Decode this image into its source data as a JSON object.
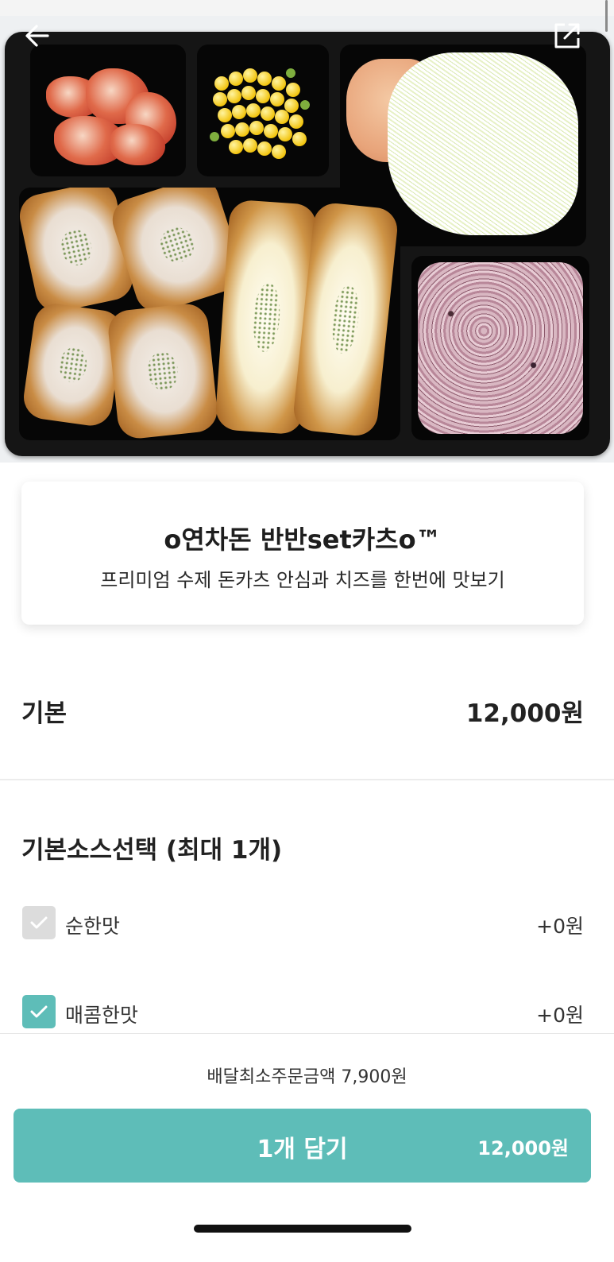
{
  "product": {
    "name": "o연차돈 반반set카츠o™",
    "description": "프리미엄 수제 돈카츠 안심과 치즈를 한번에 맛보기"
  },
  "base_price": {
    "label": "기본",
    "value": "12,000원"
  },
  "sauce_section": {
    "title": "기본소스선택 (최대 1개)",
    "options": [
      {
        "label": "순한맛",
        "price": "+0원",
        "state": "disabled"
      },
      {
        "label": "매콤한맛",
        "price": "+0원",
        "state": "checked"
      }
    ]
  },
  "footer": {
    "min_order_text": "배달최소주문금액 7,900원",
    "add_button_label": "1개 담기",
    "add_button_price": "12,000원"
  },
  "colors": {
    "accent": "#5ebdb8",
    "checkbox_disabled": "#dcdcdc"
  },
  "icons": {
    "back": "back-arrow-icon",
    "share": "share-icon",
    "check": "check-icon"
  }
}
